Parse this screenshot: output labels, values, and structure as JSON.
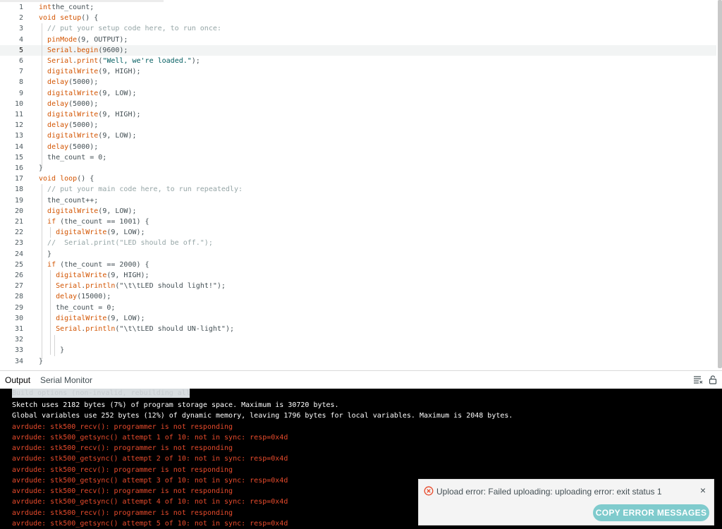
{
  "editor": {
    "lines": [
      {
        "n": "1",
        "t": [
          [
            "kw",
            "int"
          ],
          [
            "",
            "the_count;"
          ]
        ]
      },
      {
        "n": "2",
        "t": [
          [
            "kw",
            "void"
          ],
          [
            "",
            " "
          ],
          [
            "fn",
            "setup"
          ],
          [
            "",
            "() {"
          ]
        ]
      },
      {
        "n": "3",
        "t": [
          [
            "",
            "  "
          ],
          [
            "cm",
            "// put your setup code here, to run once:"
          ]
        ]
      },
      {
        "n": "4",
        "t": [
          [
            "",
            "  "
          ],
          [
            "fn",
            "pinMode"
          ],
          [
            "",
            "(9, OUTPUT);"
          ]
        ]
      },
      {
        "n": "5",
        "t": [
          [
            "",
            "  "
          ],
          [
            "fn",
            "Serial"
          ],
          [
            "",
            "."
          ],
          [
            "fn",
            "begin"
          ],
          [
            "",
            "(9600);"
          ]
        ]
      },
      {
        "n": "6",
        "t": [
          [
            "",
            "  "
          ],
          [
            "fn",
            "Serial"
          ],
          [
            "",
            "."
          ],
          [
            "fn",
            "print"
          ],
          [
            "",
            "("
          ],
          [
            "st",
            "\"Well, we're loaded.\""
          ],
          [
            "",
            ");"
          ]
        ]
      },
      {
        "n": "7",
        "t": [
          [
            "",
            "  "
          ],
          [
            "fn",
            "digitalWrite"
          ],
          [
            "",
            "(9, HIGH);"
          ]
        ]
      },
      {
        "n": "8",
        "t": [
          [
            "",
            "  "
          ],
          [
            "fn",
            "delay"
          ],
          [
            "",
            "(5000);"
          ]
        ]
      },
      {
        "n": "9",
        "t": [
          [
            "",
            "  "
          ],
          [
            "fn",
            "digitalWrite"
          ],
          [
            "",
            "(9, LOW);"
          ]
        ]
      },
      {
        "n": "10",
        "t": [
          [
            "",
            "  "
          ],
          [
            "fn",
            "delay"
          ],
          [
            "",
            "(5000);"
          ]
        ]
      },
      {
        "n": "11",
        "t": [
          [
            "",
            "  "
          ],
          [
            "fn",
            "digitalWrite"
          ],
          [
            "",
            "(9, HIGH);"
          ]
        ]
      },
      {
        "n": "12",
        "t": [
          [
            "",
            "  "
          ],
          [
            "fn",
            "delay"
          ],
          [
            "",
            "(5000);"
          ]
        ]
      },
      {
        "n": "13",
        "t": [
          [
            "",
            "  "
          ],
          [
            "fn",
            "digitalWrite"
          ],
          [
            "",
            "(9, LOW);"
          ]
        ]
      },
      {
        "n": "14",
        "t": [
          [
            "",
            "  "
          ],
          [
            "fn",
            "delay"
          ],
          [
            "",
            "(5000);"
          ]
        ]
      },
      {
        "n": "15",
        "t": [
          [
            "",
            "  the_count = 0;"
          ]
        ]
      },
      {
        "n": "16",
        "t": [
          [
            "",
            "}"
          ]
        ]
      },
      {
        "n": "17",
        "t": [
          [
            "kw",
            "void"
          ],
          [
            "",
            " "
          ],
          [
            "fn",
            "loop"
          ],
          [
            "",
            "() {"
          ]
        ]
      },
      {
        "n": "18",
        "t": [
          [
            "",
            "  "
          ],
          [
            "cm",
            "// put your main code here, to run repeatedly:"
          ]
        ]
      },
      {
        "n": "19",
        "t": [
          [
            "",
            "  the_count++;"
          ]
        ]
      },
      {
        "n": "20",
        "t": [
          [
            "",
            "  "
          ],
          [
            "fn",
            "digitalWrite"
          ],
          [
            "",
            "(9, LOW);"
          ]
        ]
      },
      {
        "n": "21",
        "t": [
          [
            "",
            "  "
          ],
          [
            "kw",
            "if"
          ],
          [
            "",
            " (the_count == 1001) {"
          ]
        ]
      },
      {
        "n": "22",
        "t": [
          [
            "",
            "    "
          ],
          [
            "fn",
            "digitalWrite"
          ],
          [
            "",
            "(9, LOW);"
          ]
        ]
      },
      {
        "n": "23",
        "t": [
          [
            "",
            "  "
          ],
          [
            "cm",
            "//  Serial.print(\"LED should be off.\");"
          ]
        ]
      },
      {
        "n": "24",
        "t": [
          [
            "",
            "  }"
          ]
        ]
      },
      {
        "n": "25",
        "t": [
          [
            "",
            "  "
          ],
          [
            "kw",
            "if"
          ],
          [
            "",
            " (the_count == 2000) {"
          ]
        ]
      },
      {
        "n": "26",
        "t": [
          [
            "",
            "    "
          ],
          [
            "fn",
            "digitalWrite"
          ],
          [
            "",
            "(9, HIGH);"
          ]
        ]
      },
      {
        "n": "27",
        "t": [
          [
            "",
            "    "
          ],
          [
            "fn",
            "Serial"
          ],
          [
            "",
            "."
          ],
          [
            "fn",
            "println"
          ],
          [
            "",
            "(\"\\t\\tLED should light!\");"
          ]
        ]
      },
      {
        "n": "28",
        "t": [
          [
            "",
            "    "
          ],
          [
            "fn",
            "delay"
          ],
          [
            "",
            "(15000);"
          ]
        ]
      },
      {
        "n": "29",
        "t": [
          [
            "",
            "    the_count = 0;"
          ]
        ]
      },
      {
        "n": "30",
        "t": [
          [
            "",
            "    "
          ],
          [
            "fn",
            "digitalWrite"
          ],
          [
            "",
            "(9, LOW);"
          ]
        ]
      },
      {
        "n": "31",
        "t": [
          [
            "",
            "    "
          ],
          [
            "fn",
            "Serial"
          ],
          [
            "",
            "."
          ],
          [
            "fn",
            "println"
          ],
          [
            "",
            "(\"\\t\\tLED should UN-light\");"
          ]
        ]
      },
      {
        "n": "32",
        "t": [
          [
            "",
            ""
          ]
        ]
      },
      {
        "n": "33",
        "t": [
          [
            "",
            "     }"
          ]
        ]
      },
      {
        "n": "34",
        "t": [
          [
            "",
            "}"
          ]
        ]
      }
    ],
    "active_line": 5
  },
  "panel": {
    "tab_output": "Output",
    "tab_serial": "Serial Monitor",
    "faded_line": "Build options (non-invalid, rebuilding all)",
    "output_lines": [
      {
        "c": "white",
        "t": "Sketch uses 2182 bytes (7%) of program storage space. Maximum is 30720 bytes."
      },
      {
        "c": "white",
        "t": "Global variables use 252 bytes (12%) of dynamic memory, leaving 1796 bytes for local variables. Maximum is 2048 bytes."
      },
      {
        "c": "red",
        "t": "avrdude: stk500_recv(): programmer is not responding"
      },
      {
        "c": "red",
        "t": "avrdude: stk500_getsync() attempt 1 of 10: not in sync: resp=0x4d"
      },
      {
        "c": "red",
        "t": "avrdude: stk500_recv(): programmer is not responding"
      },
      {
        "c": "red",
        "t": "avrdude: stk500_getsync() attempt 2 of 10: not in sync: resp=0x4d"
      },
      {
        "c": "red",
        "t": "avrdude: stk500_recv(): programmer is not responding"
      },
      {
        "c": "red",
        "t": "avrdude: stk500_getsync() attempt 3 of 10: not in sync: resp=0x4d"
      },
      {
        "c": "red",
        "t": "avrdude: stk500_recv(): programmer is not responding"
      },
      {
        "c": "red",
        "t": "avrdude: stk500_getsync() attempt 4 of 10: not in sync: resp=0x4d"
      },
      {
        "c": "red",
        "t": "avrdude: stk500_recv(): programmer is not responding"
      },
      {
        "c": "red",
        "t": "avrdude: stk500_getsync() attempt 5 of 10: not in sync: resp=0x4d"
      }
    ]
  },
  "toast": {
    "message": "Upload error: Failed uploading: uploading error: exit status 1",
    "close_glyph": "×",
    "button_label": "COPY ERROR MESSAGES"
  },
  "colors": {
    "keyword": "#d35400",
    "comment": "#95a5a6",
    "string": "#005c5f",
    "error_output": "#e84b2c",
    "button": "#7fcbcd"
  },
  "icons": {
    "clear_output": "clear-output-icon",
    "lock_scroll": "lock-icon",
    "error": "error-circle-icon"
  }
}
